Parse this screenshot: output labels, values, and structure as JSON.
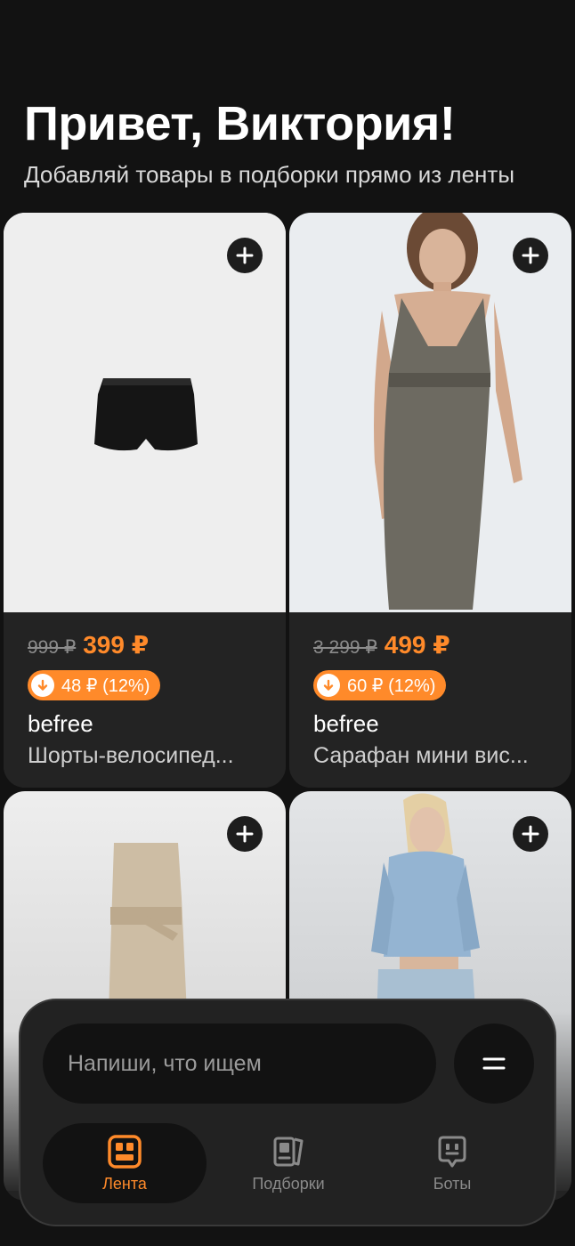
{
  "header": {
    "greeting": "Привет, Виктория!",
    "subtitle": "Добавляй товары в подборки прямо из ленты"
  },
  "products": [
    {
      "old_price": "999 ₽",
      "price": "399 ₽",
      "discount": "48 ₽ (12%)",
      "brand": "befree",
      "name": "Шорты-велосипед...",
      "image": "black-shorts"
    },
    {
      "old_price": "3 299 ₽",
      "price": "499 ₽",
      "discount": "60 ₽ (12%)",
      "brand": "befree",
      "name": "Сарафан мини вис...",
      "image": "grey-dress-model"
    },
    {
      "image": "beige-jumpsuit"
    },
    {
      "image": "denim-jacket-model"
    }
  ],
  "search": {
    "placeholder": "Напиши, что ищем"
  },
  "tabs": [
    {
      "label": "Лента",
      "icon": "feed-icon",
      "active": true
    },
    {
      "label": "Подборки",
      "icon": "collections-icon",
      "active": false
    },
    {
      "label": "Боты",
      "icon": "bots-icon",
      "active": false
    }
  ],
  "colors": {
    "accent": "#ff8a2a",
    "background": "#121212",
    "card": "#232323"
  }
}
